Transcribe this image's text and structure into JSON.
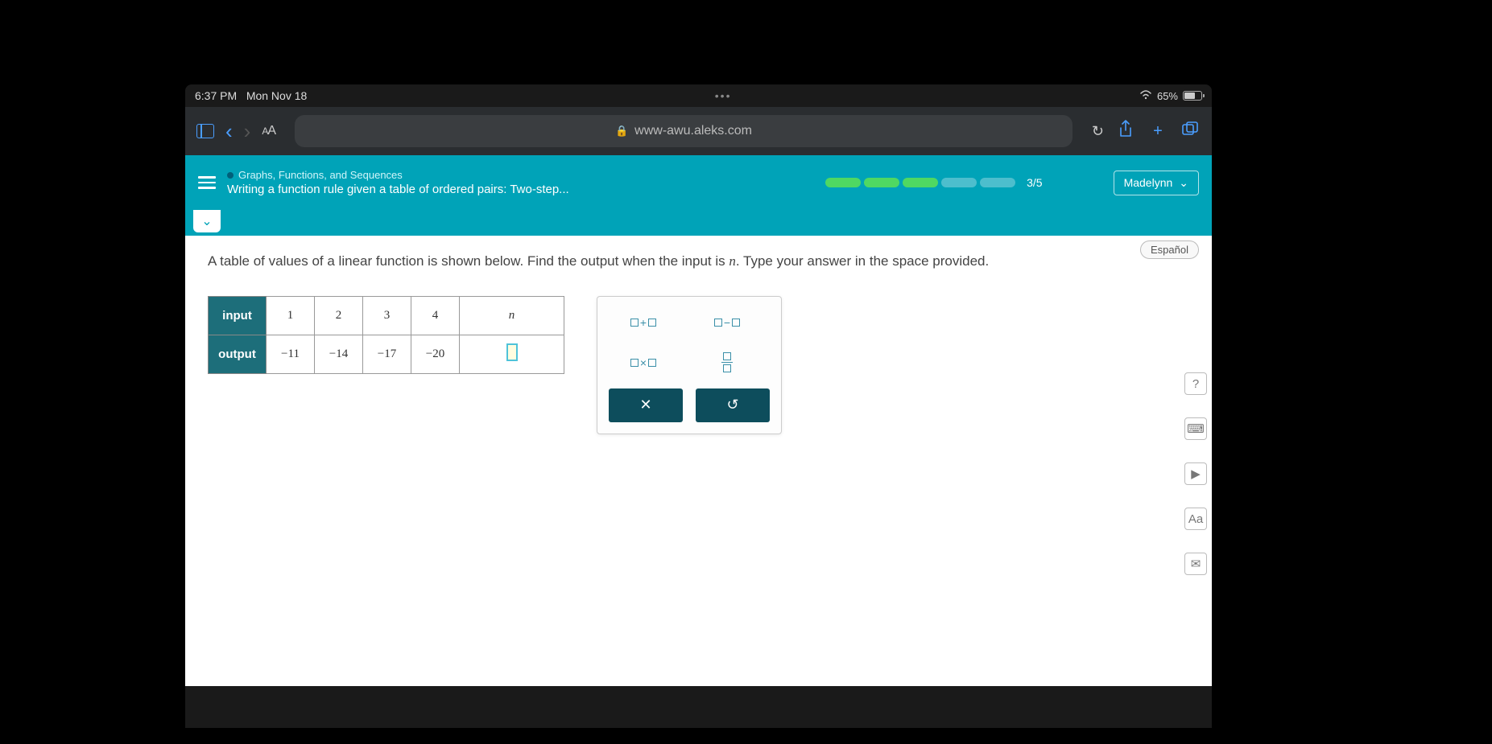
{
  "status": {
    "time": "6:37 PM",
    "date": "Mon Nov 18",
    "battery_pct": "65%"
  },
  "browser": {
    "text_size": "AA",
    "url": "www-awu.aleks.com"
  },
  "header": {
    "category": "Graphs, Functions, and Sequences",
    "topic": "Writing a function rule given a table of ordered pairs: Two-step...",
    "progress_count": "3/5",
    "user_name": "Madelynn"
  },
  "content": {
    "espanol": "Español",
    "question_1": "A table of values of a linear function is shown below. Find the output when the input is ",
    "question_var": "n",
    "question_2": ". Type your answer in the space provided."
  },
  "table": {
    "row_input_label": "input",
    "row_output_label": "output",
    "inputs": [
      "1",
      "2",
      "3",
      "4"
    ],
    "input_var": "n",
    "outputs": [
      "−11",
      "−14",
      "−17",
      "−20"
    ]
  },
  "keypad": {
    "plus": "+",
    "minus": "−",
    "times": "×",
    "clear": "✕",
    "undo": "↺"
  },
  "rail": {
    "help": "?",
    "calc": "⌨",
    "play": "▶",
    "text": "Aa",
    "mail": "✉"
  }
}
